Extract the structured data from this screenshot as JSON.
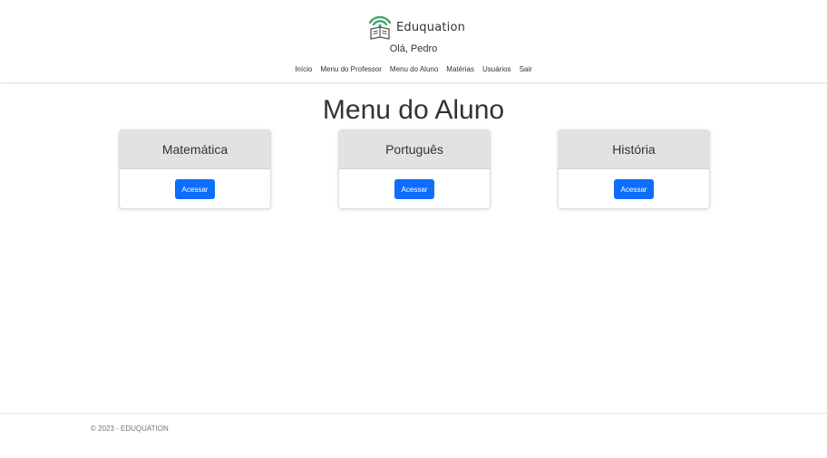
{
  "header": {
    "brand_name": "Eduquation",
    "greeting": "Olá, Pedro",
    "nav": [
      {
        "label": "Início"
      },
      {
        "label": "Menu do Professor"
      },
      {
        "label": "Menu do Aluno"
      },
      {
        "label": "Matérias"
      },
      {
        "label": "Usuários"
      },
      {
        "label": "Sair"
      }
    ]
  },
  "main": {
    "title": "Menu do Aluno",
    "cards": [
      {
        "title": "Matemática",
        "button": "Acessar"
      },
      {
        "title": "Português",
        "button": "Acessar"
      },
      {
        "title": "História",
        "button": "Acessar"
      }
    ]
  },
  "footer": {
    "text": "© 2023 - EDUQUATION"
  },
  "colors": {
    "accent": "#0d6efd",
    "logo_green": "#3aa66a",
    "card_header": "#e2e2e2"
  },
  "icons": {
    "logo": "book-wifi-icon"
  }
}
